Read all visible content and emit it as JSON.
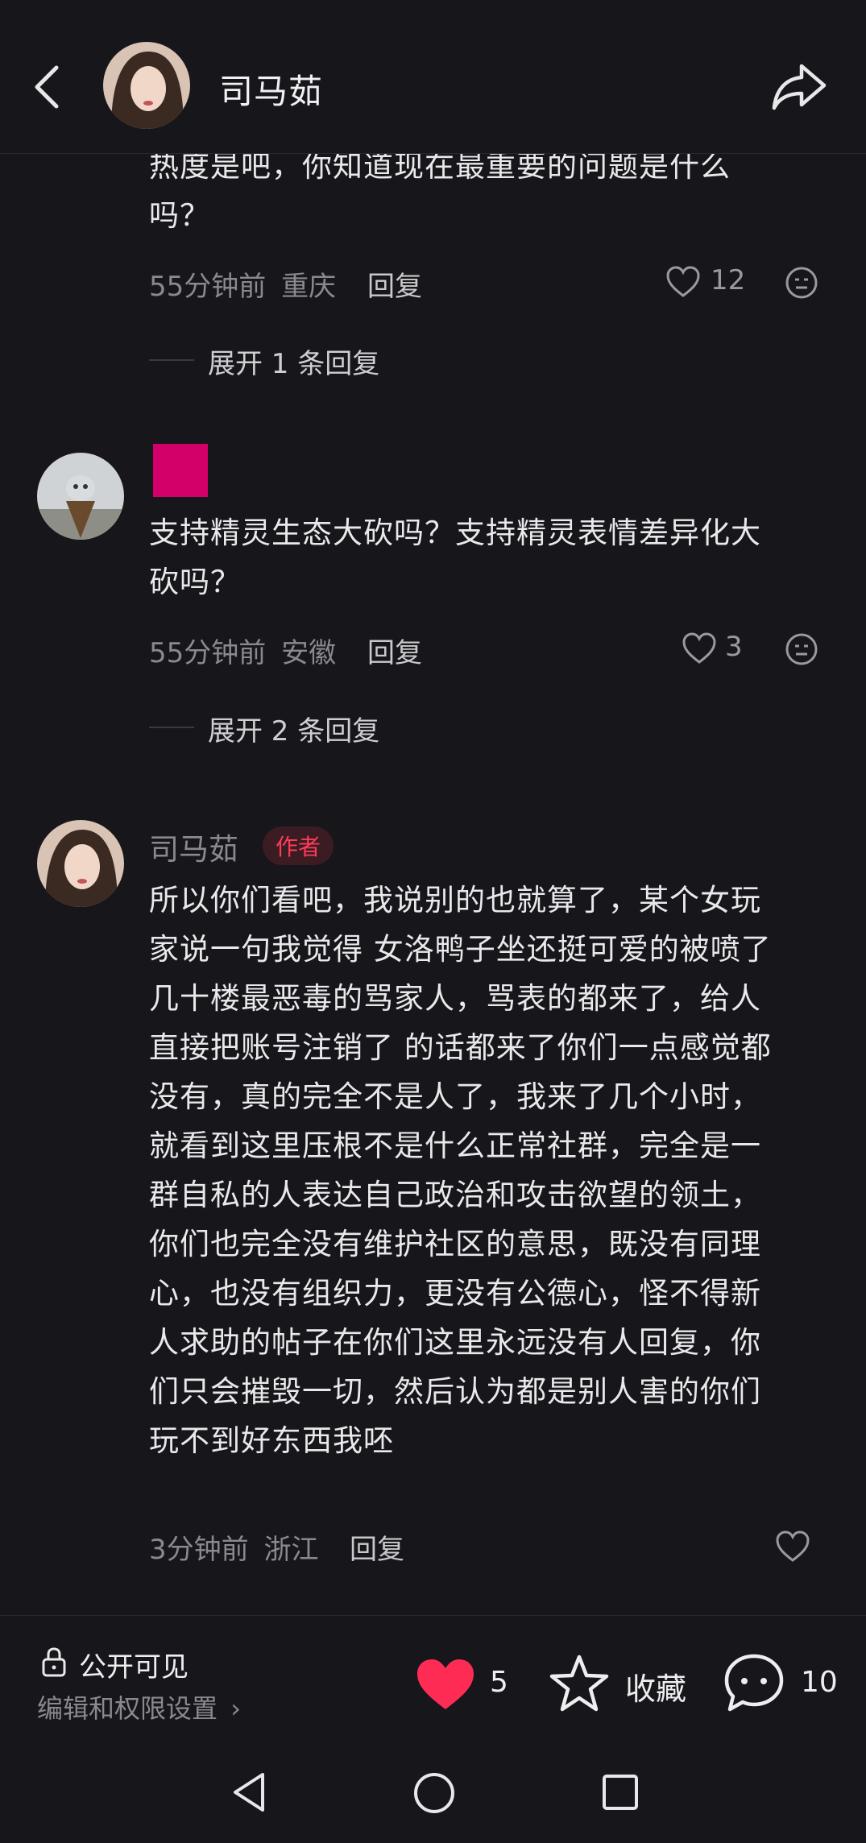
{
  "header": {
    "name": "司马茹"
  },
  "comments": [
    {
      "text_line1": "热度是吧，你知道现在最重要的问题是什么",
      "text_line2": "吗？",
      "time": "55分钟前",
      "location": "重庆",
      "reply_label": "回复",
      "likes": "12",
      "expand": "展开 1 条回复"
    },
    {
      "text_line1": "支持精灵生态大砍吗？支持精灵表情差异化大",
      "text_line2": "砍吗？",
      "time": "55分钟前",
      "location": "安徽",
      "reply_label": "回复",
      "likes": "3",
      "expand": "展开 2 条回复"
    },
    {
      "author": "司马茹",
      "badge": "作者",
      "lines": [
        "所以你们看吧，我说别的也就算了，某个女玩",
        "家说一句我觉得 女洛鸭子坐还挺可爱的被喷了",
        "几十楼最恶毒的骂家人，骂表的都来了，给人",
        "直接把账号注销了 的话都来了你们一点感觉都",
        "没有，真的完全不是人了，我来了几个小时，",
        "就看到这里压根不是什么正常社群，完全是一",
        "群自私的人表达自己政治和攻击欲望的领土，",
        "你们也完全没有维护社区的意思，既没有同理",
        "心，也没有组织力，更没有公德心，怪不得新",
        "人求助的帖子在你们这里永远没有人回复，你",
        "们只会摧毁一切，然后认为都是别人害的你们",
        "玩不到好东西我呸"
      ],
      "time": "3分钟前",
      "location": "浙江",
      "reply_label": "回复"
    }
  ],
  "bottom": {
    "visibility": "公开可见",
    "settings": "编辑和权限设置",
    "likes": "5",
    "collect": "收藏",
    "comments": "10"
  },
  "colors": {
    "accent_red": "#ff3b5a",
    "heart": "#fe2c55",
    "bg": "#17161b"
  }
}
